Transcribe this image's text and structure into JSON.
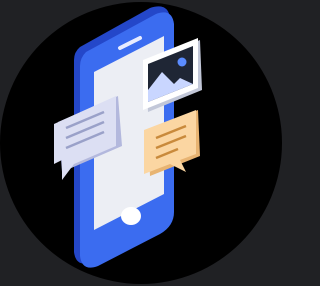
{
  "illustration": {
    "subject": "smartphone-messaging-icon",
    "colors": {
      "page_background": "#202124",
      "circle_background": "#000000",
      "phone_body": "#3b6cf0",
      "phone_body_dark": "#2447c9",
      "screen": "#eceef4",
      "bubble_lavender": "#dcdff3",
      "bubble_lavender_dark": "#b3b8dd",
      "bubble_peach": "#fbd6a2",
      "bubble_peach_dark": "#e8b472",
      "image_card_frame": "#ffffff",
      "image_card_bg": "#1f2635",
      "mountain": "#c9d6ff",
      "sun": "#5b8cff"
    },
    "icons": [
      "phone-icon",
      "chat-bubble-icon",
      "image-icon",
      "home-button-icon"
    ]
  }
}
